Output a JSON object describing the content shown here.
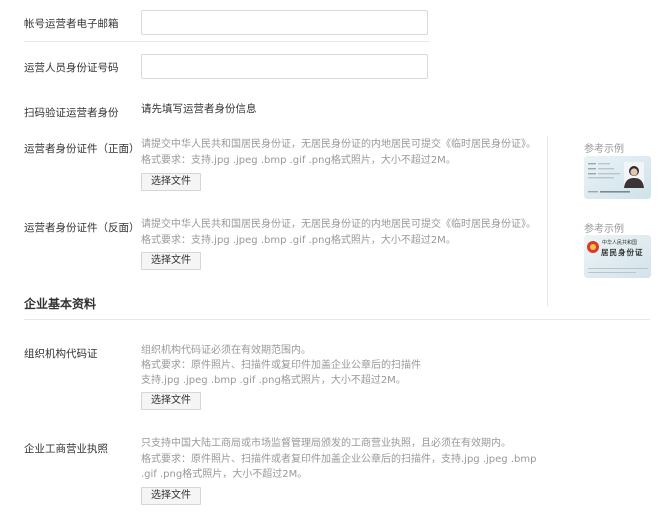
{
  "fields": {
    "email": {
      "label": "帐号运营者电子邮箱",
      "value": "",
      "placeholder": ""
    },
    "id_number": {
      "label": "运营人员身份证号码",
      "value": "",
      "placeholder": ""
    },
    "scan_verify": {
      "label": "扫码验证运营者身份",
      "text": "请先填写运营者身份信息"
    }
  },
  "id_front": {
    "label": "运营者身份证件（正面）",
    "note1": "请提交中华人民共和国居民身份证，无居民身份证的内地居民可提交《临时居民身份证》。",
    "note2": "格式要求：支持.jpg .jpeg .bmp .gif .png格式照片，大小不超过2M。",
    "button": "选择文件",
    "ref_title": "参考示例"
  },
  "id_back": {
    "label": "运营者身份证件（反面）",
    "note1": "请提交中华人民共和国居民身份证，无居民身份证的内地居民可提交《临时居民身份证》。",
    "note2": "格式要求：支持.jpg .jpeg .bmp .gif .png格式照片，大小不超过2M。",
    "button": "选择文件",
    "ref_title": "参考示例",
    "card_text1": "中华人民共和国",
    "card_text2": "居民身份证"
  },
  "company": {
    "section_title": "企业基本资料",
    "org_code": {
      "label": "组织机构代码证",
      "note1": "组织机构代码证必须在有效期范围内。",
      "note2": "格式要求：原件照片、扫描件或复印件加盖企业公章后的扫描件",
      "note3": "支持.jpg .jpeg .bmp .gif .png格式照片，大小不超过2M。",
      "button": "选择文件"
    },
    "business_license": {
      "label": "企业工商营业执照",
      "note1": "只支持中国大陆工商局或市场监督管理局颁发的工商营业执照，且必须在有效期内。",
      "note2": "格式要求：原件照片、扫描件或者复印件加盖企业公章后的扫描件，支持.jpg .jpeg .bmp",
      "note3": ".gif .png格式照片，大小不超过2M。",
      "button": "选择文件"
    }
  },
  "colors": {
    "border": "#d9d9d9",
    "divider": "#e8e8e8",
    "note_text": "#999999",
    "button_bg": "#f5f5f5"
  }
}
